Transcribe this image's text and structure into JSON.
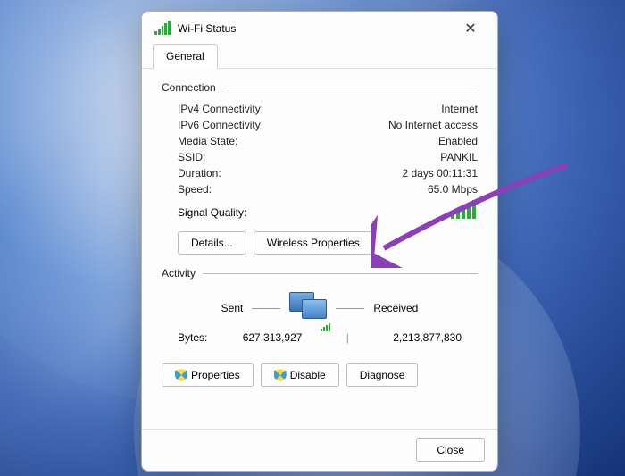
{
  "window": {
    "title": "Wi-Fi Status"
  },
  "tab": {
    "general": "General"
  },
  "connection": {
    "section_label": "Connection",
    "ipv4_label": "IPv4 Connectivity:",
    "ipv4_value": "Internet",
    "ipv6_label": "IPv6 Connectivity:",
    "ipv6_value": "No Internet access",
    "media_state_label": "Media State:",
    "media_state_value": "Enabled",
    "ssid_label": "SSID:",
    "ssid_value": "PANKIL",
    "duration_label": "Duration:",
    "duration_value": "2 days 00:11:31",
    "speed_label": "Speed:",
    "speed_value": "65.0 Mbps",
    "signal_quality_label": "Signal Quality:"
  },
  "buttons": {
    "details": "Details...",
    "wireless_properties": "Wireless Properties",
    "properties": "Properties",
    "disable": "Disable",
    "diagnose": "Diagnose",
    "close": "Close"
  },
  "activity": {
    "section_label": "Activity",
    "sent_label": "Sent",
    "received_label": "Received",
    "bytes_label": "Bytes:",
    "sent_value": "627,313,927",
    "received_value": "2,213,877,830"
  }
}
